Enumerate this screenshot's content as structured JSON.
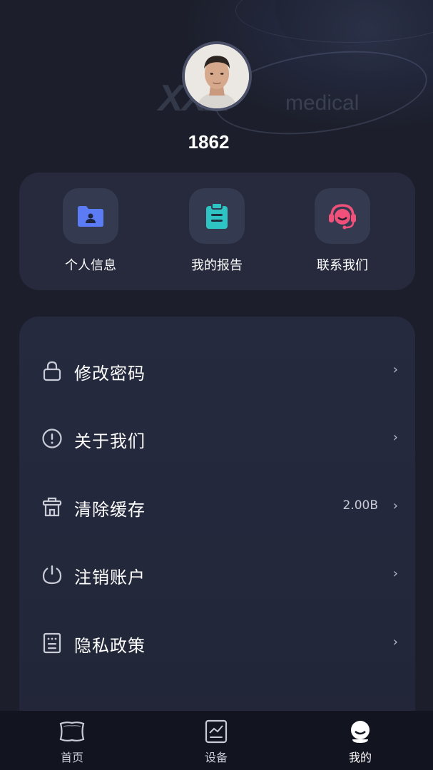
{
  "header": {
    "logo_text": "medical",
    "username": "1862"
  },
  "quick_actions": [
    {
      "label": "个人信息",
      "icon": "person-folder-icon",
      "color": "#5b7cf5"
    },
    {
      "label": "我的报告",
      "icon": "clipboard-icon",
      "color": "#2ec4c4"
    },
    {
      "label": "联系我们",
      "icon": "headset-icon",
      "color": "#f0507a"
    }
  ],
  "menu": [
    {
      "label": "修改密码",
      "icon": "lock-icon",
      "value": ""
    },
    {
      "label": "关于我们",
      "icon": "info-circle-icon",
      "value": ""
    },
    {
      "label": "清除缓存",
      "icon": "trash-icon",
      "value": "2.00B"
    },
    {
      "label": "注销账户",
      "icon": "power-icon",
      "value": ""
    },
    {
      "label": "隐私政策",
      "icon": "document-icon",
      "value": ""
    }
  ],
  "chevron": "›",
  "tabs": [
    {
      "label": "首页",
      "icon": "pillow-icon",
      "active": false
    },
    {
      "label": "设备",
      "icon": "chart-device-icon",
      "active": false
    },
    {
      "label": "我的",
      "icon": "profile-face-icon",
      "active": true
    }
  ]
}
